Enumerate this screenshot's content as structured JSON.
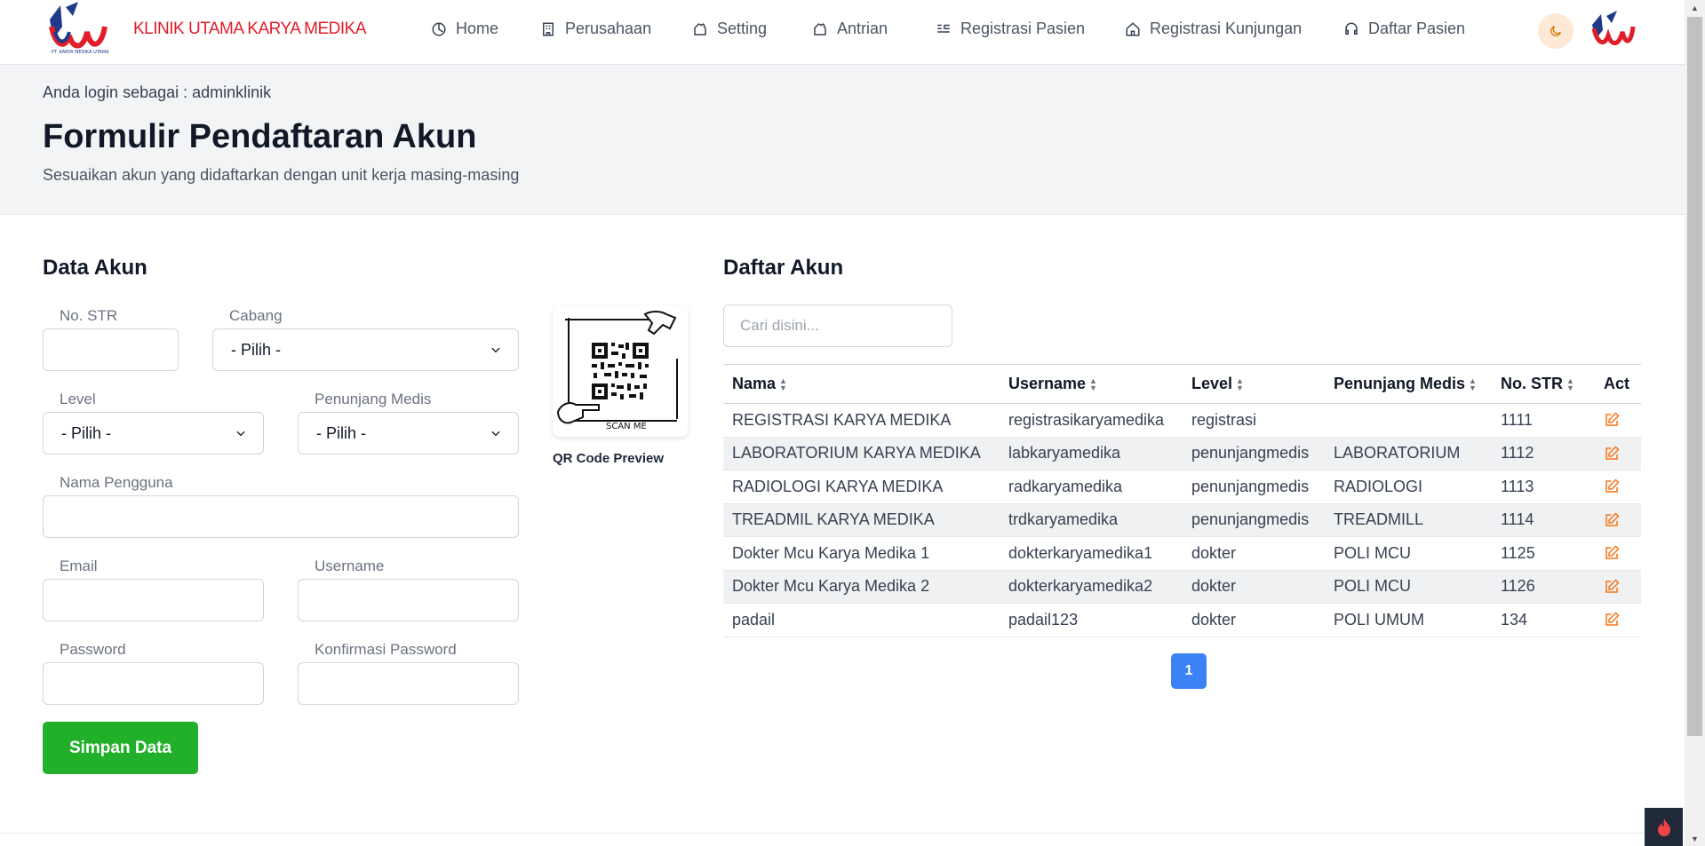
{
  "brand": {
    "name": "KLINIK UTAMA KARYA MEDIKA",
    "logo_caption": "PT. KARYA MEDIKA UTAMA"
  },
  "nav": {
    "items": [
      {
        "label": "Home",
        "icon": "clock-icon"
      },
      {
        "label": "Perusahaan",
        "icon": "building-icon"
      },
      {
        "label": "Setting",
        "icon": "puzzle-icon"
      },
      {
        "label": "Antrian",
        "icon": "puzzle-icon"
      },
      {
        "label": "Registrasi Pasien",
        "icon": "list-icon"
      },
      {
        "label": "Registrasi Kunjungan",
        "icon": "home-icon"
      },
      {
        "label": "Daftar Pasien",
        "icon": "headset-icon"
      }
    ]
  },
  "colors": {
    "brand_red": "#e11d2a",
    "save_green": "#22b02b",
    "accent_orange": "#f97316",
    "page_blue": "#3b82f6"
  },
  "header": {
    "login_info": "Anda login sebagai : adminklinik",
    "title": "Formulir Pendaftaran Akun",
    "subtitle": "Sesuaikan akun yang didaftarkan dengan unit kerja masing-masing"
  },
  "form": {
    "title": "Data Akun",
    "no_str_label": "No. STR",
    "cabang_label": "Cabang",
    "cabang_value": "- Pilih -",
    "level_label": "Level",
    "level_value": "- Pilih -",
    "penunjang_label": "Penunjang Medis",
    "penunjang_value": "- Pilih -",
    "nama_label": "Nama Pengguna",
    "email_label": "Email",
    "username_label": "Username",
    "password_label": "Password",
    "konfirmasi_label": "Konfirmasi Password",
    "save_label": "Simpan Data"
  },
  "qr": {
    "label": "QR Code Preview",
    "scan_text": "SCAN ME"
  },
  "table": {
    "title": "Daftar Akun",
    "search_placeholder": "Cari disini...",
    "headers": [
      "Nama",
      "Username",
      "Level",
      "Penunjang Medis",
      "No. STR",
      "Act"
    ],
    "rows": [
      [
        "REGISTRASI KARYA MEDIKA",
        "registrasikaryamedika",
        "registrasi",
        "",
        "1111"
      ],
      [
        "LABORATORIUM KARYA MEDIKA",
        "labkaryamedika",
        "penunjangmedis",
        "LABORATORIUM",
        "1112"
      ],
      [
        "RADIOLOGI KARYA MEDIKA",
        "radkaryamedika",
        "penunjangmedis",
        "RADIOLOGI",
        "1113"
      ],
      [
        "TREADMIL KARYA MEDIKA",
        "trdkaryamedika",
        "penunjangmedis",
        "TREADMILL",
        "1114"
      ],
      [
        "Dokter Mcu Karya Medika 1",
        "dokterkaryamedika1",
        "dokter",
        "POLI MCU",
        "1125"
      ],
      [
        "Dokter Mcu Karya Medika 2",
        "dokterkaryamedika2",
        "dokter",
        "POLI MCU",
        "1126"
      ],
      [
        "padail",
        "padail123",
        "dokter",
        "POLI UMUM",
        "134"
      ]
    ],
    "current_page": "1"
  }
}
